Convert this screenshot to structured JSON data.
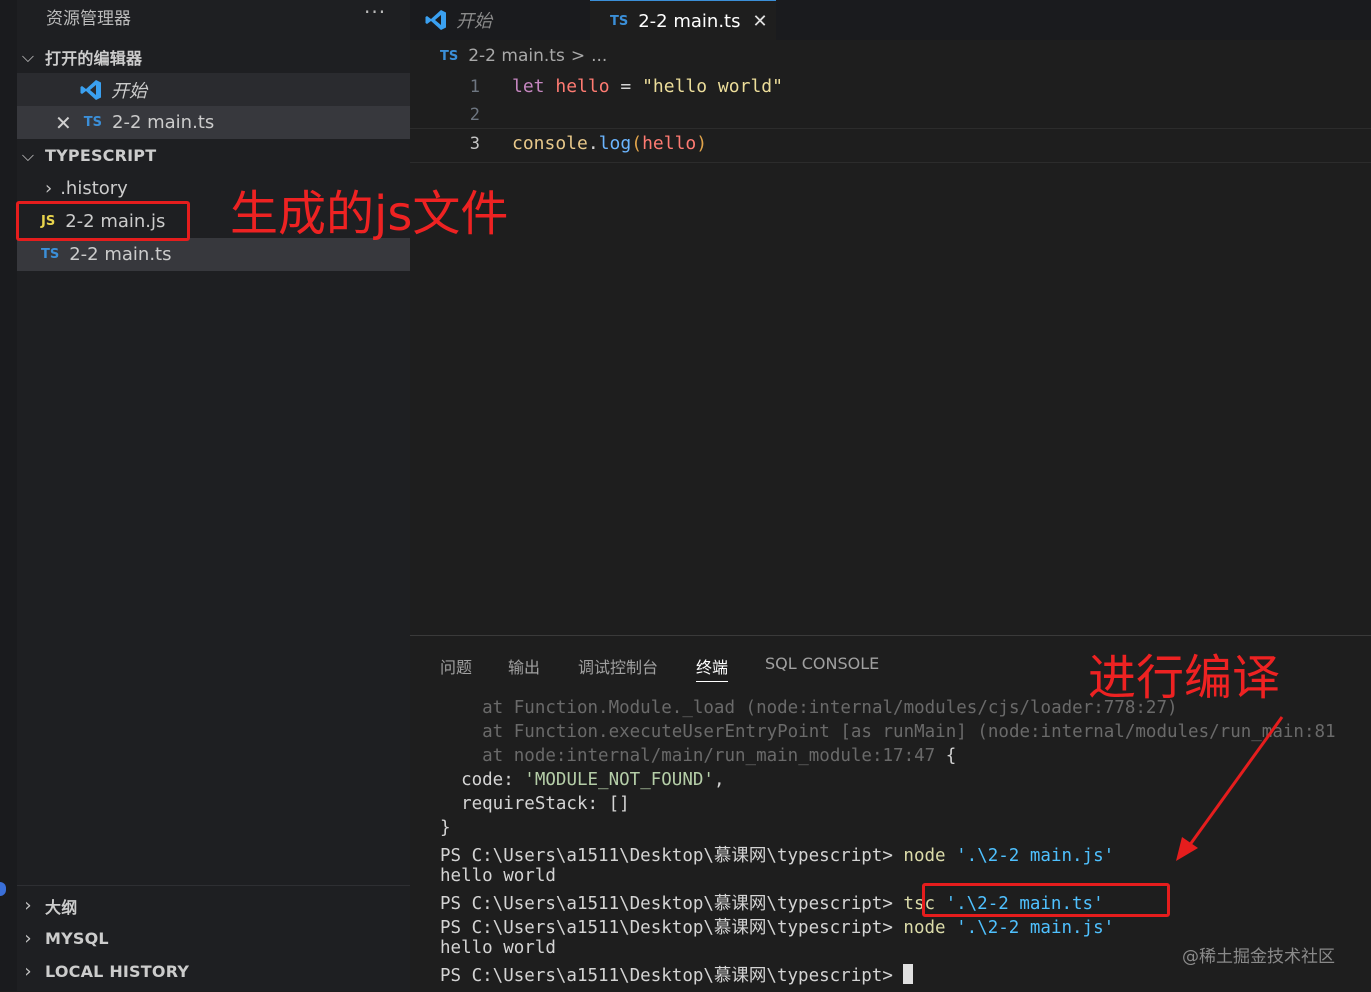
{
  "sidebar": {
    "title": "资源管理器",
    "more": "···",
    "open_editors": {
      "header": "打开的编辑器",
      "items": [
        {
          "label": "开始"
        },
        {
          "badge": "TS",
          "label": "2-2 main.ts"
        }
      ]
    },
    "typescript": {
      "header": "TYPESCRIPT",
      "items": [
        {
          "label": ".history"
        },
        {
          "badge": "JS",
          "label": "2-2 main.js"
        },
        {
          "badge": "TS",
          "label": "2-2 main.ts"
        }
      ]
    },
    "bottom_sections": [
      "大纲",
      "MYSQL",
      "LOCAL HISTORY"
    ]
  },
  "tabs": [
    {
      "label": "开始"
    },
    {
      "badge": "TS",
      "label": "2-2 main.ts",
      "close": "✕"
    }
  ],
  "breadcrumb": {
    "badge": "TS",
    "file": "2-2 main.ts",
    "sep": ">",
    "rest": "..."
  },
  "editor": {
    "lines": [
      {
        "num": "1"
      },
      {
        "num": "2"
      },
      {
        "num": "3"
      }
    ],
    "line1": {
      "kw": "let",
      "var": "hello",
      "op": "=",
      "str": "\"hello world\""
    },
    "line3": {
      "obj": "console",
      "dot": ".",
      "fn": "log",
      "open": "(",
      "arg": "hello",
      "close": ")"
    }
  },
  "panel": {
    "tabs": [
      "问题",
      "输出",
      "调试控制台",
      "终端",
      "SQL CONSOLE"
    ],
    "active_tab": "终端",
    "terminal": {
      "l1": "    at Function.Module._load (node:internal/modules/cjs/loader:778:27)",
      "l2": "    at Function.executeUserEntryPoint [as runMain] (node:internal/modules/run_main:81",
      "l3a": "    at node:internal/main/run_main_module:17:47",
      "l3b": " {",
      "l4a": "  code: ",
      "l4b": "'MODULE_NOT_FOUND'",
      "l4c": ",",
      "l5": "  requireStack: []",
      "l6": "}",
      "prompt": "PS C:\\Users\\a1511\\Desktop\\慕课网\\typescript>",
      "cmd1": "node",
      "arg1": "'.\\2-2 main.js'",
      "out1": "hello world",
      "cmd2": "tsc",
      "arg2": "'.\\2-2 main.ts'",
      "cmd3": "node",
      "arg3": "'.\\2-2 main.js'",
      "out2": "hello world"
    }
  },
  "annotations": {
    "generated": "生成的js文件",
    "compile": "进行编译",
    "watermark": "@稀土掘金技术社区"
  },
  "colors": {
    "annotation_red": "#e51d1d",
    "ts_blue": "#3b8fd8",
    "js_yellow": "#e8d44d"
  }
}
